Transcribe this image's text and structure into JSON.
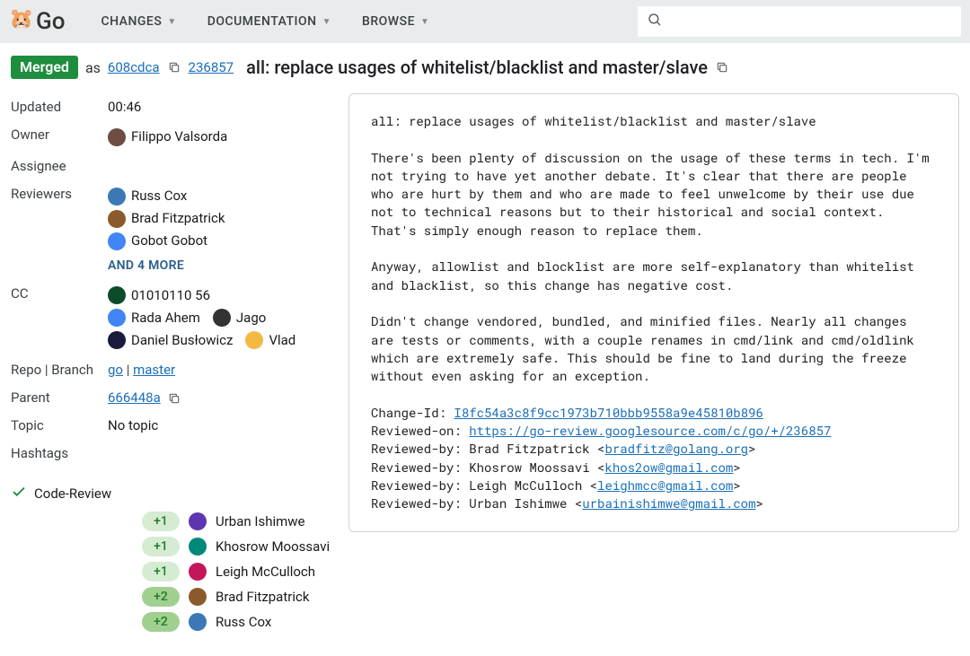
{
  "header": {
    "app_name": "Go",
    "nav": [
      {
        "label": "CHANGES"
      },
      {
        "label": "DOCUMENTATION"
      },
      {
        "label": "BROWSE"
      }
    ],
    "search_placeholder": ""
  },
  "subheader": {
    "status": "Merged",
    "as_text": "as",
    "commit_sha": "608cdca",
    "change_number": "236857",
    "title": "all: replace usages of whitelist/blacklist and master/slave"
  },
  "meta": {
    "updated_label": "Updated",
    "updated_value": "00:46",
    "owner_label": "Owner",
    "owner_name": "Filippo Valsorda",
    "assignee_label": "Assignee",
    "reviewers_label": "Reviewers",
    "reviewers": [
      {
        "name": "Russ Cox"
      },
      {
        "name": "Brad Fitzpatrick"
      },
      {
        "name": "Gobot Gobot"
      }
    ],
    "more_reviewers": "AND 4 MORE",
    "cc_label": "CC",
    "cc": [
      {
        "name": "01010110 56"
      },
      {
        "name": "Rada Ahem"
      },
      {
        "name": "Jago"
      },
      {
        "name": "Daniel Busłowicz"
      },
      {
        "name": "Vlad"
      }
    ],
    "repo_label": "Repo | Branch",
    "repo_name": "go",
    "branch_name": "master",
    "parent_label": "Parent",
    "parent_sha": "666448a",
    "topic_label": "Topic",
    "topic_value": "No topic",
    "hashtags_label": "Hashtags"
  },
  "code_review": {
    "label": "Code-Review",
    "votes": [
      {
        "score": "+1",
        "name": "Urban Ishimwe"
      },
      {
        "score": "+1",
        "name": "Khosrow Moossavi"
      },
      {
        "score": "+1",
        "name": "Leigh McCulloch"
      },
      {
        "score": "+2",
        "name": "Brad Fitzpatrick"
      },
      {
        "score": "+2",
        "name": "Russ Cox"
      }
    ]
  },
  "commit_message": {
    "title_line": "all: replace usages of whitelist/blacklist and master/slave",
    "para1": "There's been plenty of discussion on the usage of these terms in tech. I'm not trying to have yet another debate. It's clear that there are people who are hurt by them and who are made to feel unwelcome by their use due not to technical reasons but to their historical and social context. That's simply enough reason to replace them.",
    "para2": "Anyway, allowlist and blocklist are more self-explanatory than whitelist and blacklist, so this change has negative cost.",
    "para3": "Didn't change vendored, bundled, and minified files. Nearly all changes are tests or comments, with a couple renames in cmd/link and cmd/oldlink which are extremely safe. This should be fine to land during the freeze without even asking for an exception.",
    "change_id_label": "Change-Id: ",
    "change_id": "I8fc54a3c8f9cc1973b710bbb9558a9e45810b896",
    "reviewed_on_label": "Reviewed-on: ",
    "reviewed_on_url": "https://go-review.googlesource.com/c/go/+/236857",
    "rb1_prefix": "Reviewed-by: Brad Fitzpatrick <",
    "rb1_email": "bradfitz@golang.org",
    "rb2_prefix": "Reviewed-by: Khosrow Moossavi <",
    "rb2_email": "khos2ow@gmail.com",
    "rb3_prefix": "Reviewed-by: Leigh McCulloch <",
    "rb3_email": "leighmcc@gmail.com",
    "rb4_prefix": "Reviewed-by: Urban Ishimwe <",
    "rb4_email": "urbainishimwe@gmail.com",
    "close": ">"
  }
}
